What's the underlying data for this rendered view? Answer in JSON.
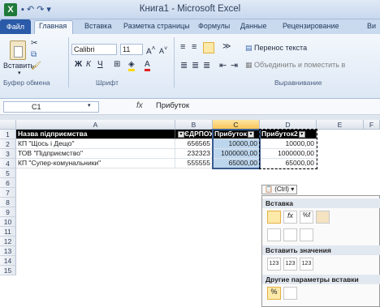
{
  "window": {
    "title": "Книга1 - Microsoft Excel",
    "qat_icons": [
      "save-icon",
      "undo-icon",
      "redo-icon"
    ],
    "app_glyph": "X"
  },
  "tabs": [
    {
      "label": "Файл"
    },
    {
      "label": "Главная"
    },
    {
      "label": "Вставка"
    },
    {
      "label": "Разметка страницы"
    },
    {
      "label": "Формулы"
    },
    {
      "label": "Данные"
    },
    {
      "label": "Рецензирование"
    },
    {
      "label": "Ви"
    }
  ],
  "ribbon": {
    "clipboard": {
      "paste_label": "Вставить",
      "group_label": "Буфер обмена"
    },
    "font": {
      "name": "Calibri",
      "size": "11",
      "bold": "Ж",
      "italic": "К",
      "underline": "Ч",
      "group_label": "Шрифт"
    },
    "alignment": {
      "wrap_text": "Перенос текста",
      "merge": "Объединить и поместить в",
      "group_label": "Выравнивание"
    }
  },
  "formula_bar": {
    "cell_ref": "C1",
    "fx": "fx",
    "value": "Прибуток"
  },
  "columns": [
    "A",
    "B",
    "C",
    "D",
    "E",
    "F"
  ],
  "rows": [
    "1",
    "2",
    "3",
    "4",
    "5",
    "6",
    "7",
    "8",
    "9",
    "10",
    "11",
    "12",
    "13",
    "14",
    "15"
  ],
  "table": {
    "headers": [
      "Назва підприємства",
      "ЄДРПОУ",
      "Прибуток",
      "Прибуток2"
    ],
    "rows": [
      [
        "КП \"Щось і Дещо\"",
        "656565",
        "10000,00",
        "10000,00"
      ],
      [
        "ТОВ \"Підприємство\"",
        "232323",
        "1000000,00",
        "1000000,00"
      ],
      [
        "КП \"Супер-комунальники\"",
        "555555",
        "65000,00",
        "65000,00"
      ]
    ]
  },
  "paste_options": {
    "button_label": "(Ctrl)",
    "section_paste": "Вставка",
    "section_values": "Вставить значения",
    "section_other": "Другие параметры вставки"
  },
  "colors": {
    "accent": "#2a5aa8",
    "selection": "#bcd6ee",
    "header_fill": "#000000"
  }
}
